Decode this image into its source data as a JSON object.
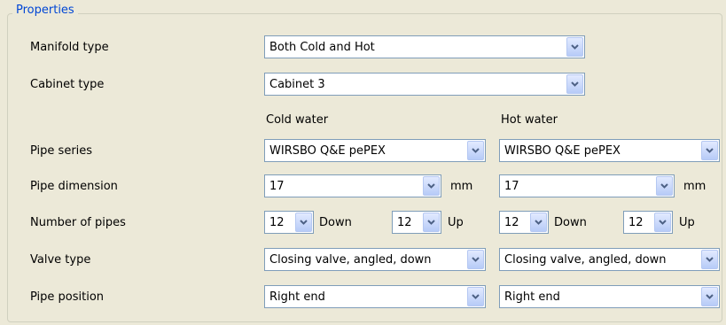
{
  "group": {
    "legend": "Properties"
  },
  "labels": {
    "manifold_type": "Manifold type",
    "cabinet_type": "Cabinet type",
    "pipe_series": "Pipe series",
    "pipe_dimension": "Pipe dimension",
    "number_of_pipes": "Number of pipes",
    "valve_type": "Valve type",
    "pipe_position": "Pipe position"
  },
  "manifold_type_value": "Both Cold and Hot",
  "cabinet_type_value": "Cabinet 3",
  "cold": {
    "header": "Cold water",
    "pipe_series": "WIRSBO Q&E pePEX",
    "pipe_dimension": "17",
    "dimension_unit": "mm",
    "pipes_down": "12",
    "down_label": "Down",
    "pipes_up": "12",
    "up_label": "Up",
    "valve_type": "Closing valve, angled, down",
    "pipe_position": "Right end"
  },
  "hot": {
    "header": "Hot water",
    "pipe_series": "WIRSBO Q&E pePEX",
    "pipe_dimension": "17",
    "dimension_unit": "mm",
    "pipes_down": "12",
    "down_label": "Down",
    "pipes_up": "12",
    "up_label": "Up",
    "valve_type": "Closing valve, angled, down",
    "pipe_position": "Right end"
  },
  "icons": {
    "dropdown": "chevron-down-icon"
  },
  "colors": {
    "legend": "#0046d5",
    "field_border": "#7f9db9",
    "background": "#ece9d8"
  }
}
